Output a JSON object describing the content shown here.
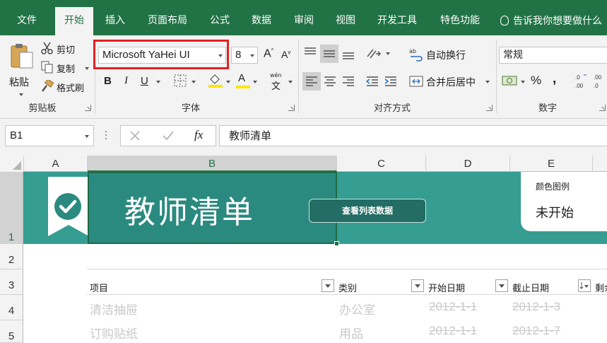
{
  "menu": {
    "tabs": [
      {
        "label": "文件"
      },
      {
        "label": "开始"
      },
      {
        "label": "插入"
      },
      {
        "label": "页面布局"
      },
      {
        "label": "公式"
      },
      {
        "label": "数据"
      },
      {
        "label": "审阅"
      },
      {
        "label": "视图"
      },
      {
        "label": "开发工具"
      },
      {
        "label": "特色功能"
      }
    ],
    "active_tab": "开始",
    "tellme": "告诉我你想要做什么"
  },
  "ribbon": {
    "clipboard": {
      "paste": "粘贴",
      "cut": "剪切",
      "copy": "复制",
      "format_painter": "格式刷",
      "label": "剪贴板"
    },
    "font": {
      "name": "Microsoft YaHei UI",
      "size": "8",
      "label": "字体",
      "bold": "B",
      "italic": "I",
      "underline": "U",
      "font_color_letter": "A",
      "phonetic": "wén"
    },
    "alignment": {
      "wrap": "自动换行",
      "merge": "合并后居中",
      "label": "对齐方式"
    },
    "number": {
      "format": "常规",
      "label": "数字",
      "percent": "%",
      "comma": ","
    }
  },
  "formula_bar": {
    "name_box": "B1",
    "content": "教师清单",
    "fx": "fx"
  },
  "grid": {
    "columns": [
      "A",
      "B",
      "C",
      "D",
      "E"
    ],
    "rows": [
      "1",
      "2",
      "3",
      "4",
      "5"
    ],
    "banner_title": "教师清单",
    "view_button": "查看列表数据",
    "legend_label": "颜色图例",
    "legend_status": "未开始",
    "headers": {
      "item": "项目",
      "category": "类别",
      "start": "开始日期",
      "end": "截止日期",
      "remaining": "剩余"
    },
    "rows_data": [
      {
        "item": "清洁抽屉",
        "category": "办公室",
        "start": "2012-1-1",
        "end": "2012-1-3"
      },
      {
        "item": "订购贴纸",
        "category": "用品",
        "start": "2012-1-1",
        "end": "2012-1-7"
      }
    ]
  },
  "colors": {
    "excel_green": "#217346",
    "banner": "#359d91",
    "banner_dark": "#2b8a7f",
    "highlight": "#e52020"
  }
}
